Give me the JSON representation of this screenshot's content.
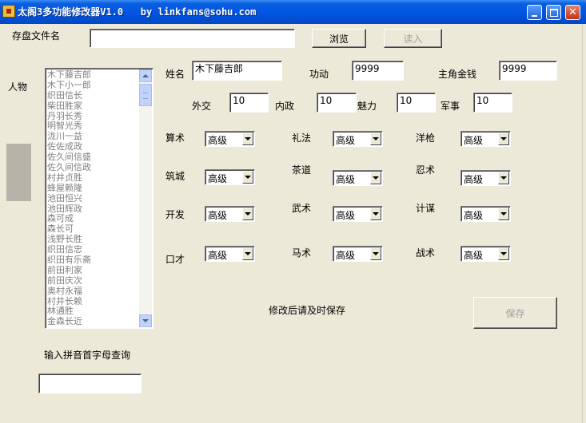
{
  "window": {
    "title": "太阁3多功能修改器V1.0   by linkfans@sohu.com"
  },
  "file": {
    "label": "存盘文件名",
    "value": "",
    "browse_label": "浏览",
    "load_label": "读入"
  },
  "person": {
    "label": "人物",
    "list": [
      "木下藤吉郎",
      "木下小一郎",
      "织田信长",
      "柴田胜家",
      "丹羽长秀",
      "明智光秀",
      "泷川一益",
      "佐佐成政",
      "佐久间信盛",
      "佐久间信政",
      "村井贞胜",
      "蜂屋赖隆",
      "池田恒兴",
      "池田辉政",
      "森可成",
      "森长可",
      "浅野长胜",
      "织田信忠",
      "织田有乐斋",
      "前田利家",
      "前田庆次",
      "奥村永福",
      "村井长赖",
      "林通胜",
      "金森长近"
    ]
  },
  "stats": {
    "name_label": "姓名",
    "name_value": "木下藤吉郎",
    "merit_label": "功动",
    "merit_value": "9999",
    "money_label": "主角金钱",
    "money_value": "9999",
    "diplomacy_label": "外交",
    "diplomacy_value": "10",
    "politics_label": "内政",
    "politics_value": "10",
    "charm_label": "魅力",
    "charm_value": "10",
    "military_label": "军事",
    "military_value": "10"
  },
  "skills": [
    {
      "label": "算术",
      "value": "高级"
    },
    {
      "label": "礼法",
      "value": "高级"
    },
    {
      "label": "洋枪",
      "value": "高级"
    },
    {
      "label": "筑城",
      "value": "高级"
    },
    {
      "label": "茶道",
      "value": "高级"
    },
    {
      "label": "忍术",
      "value": "高级"
    },
    {
      "label": "开发",
      "value": "高级"
    },
    {
      "label": "武术",
      "value": "高级"
    },
    {
      "label": "计谋",
      "value": "高级"
    },
    {
      "label": "口才",
      "value": "高级"
    },
    {
      "label": "马术",
      "value": "高级"
    },
    {
      "label": "战术",
      "value": "高级"
    }
  ],
  "footer": {
    "save_hint": "修改后请及时保存",
    "save_label": "保存",
    "search_label": "输入拼音首字母查询",
    "search_value": ""
  }
}
